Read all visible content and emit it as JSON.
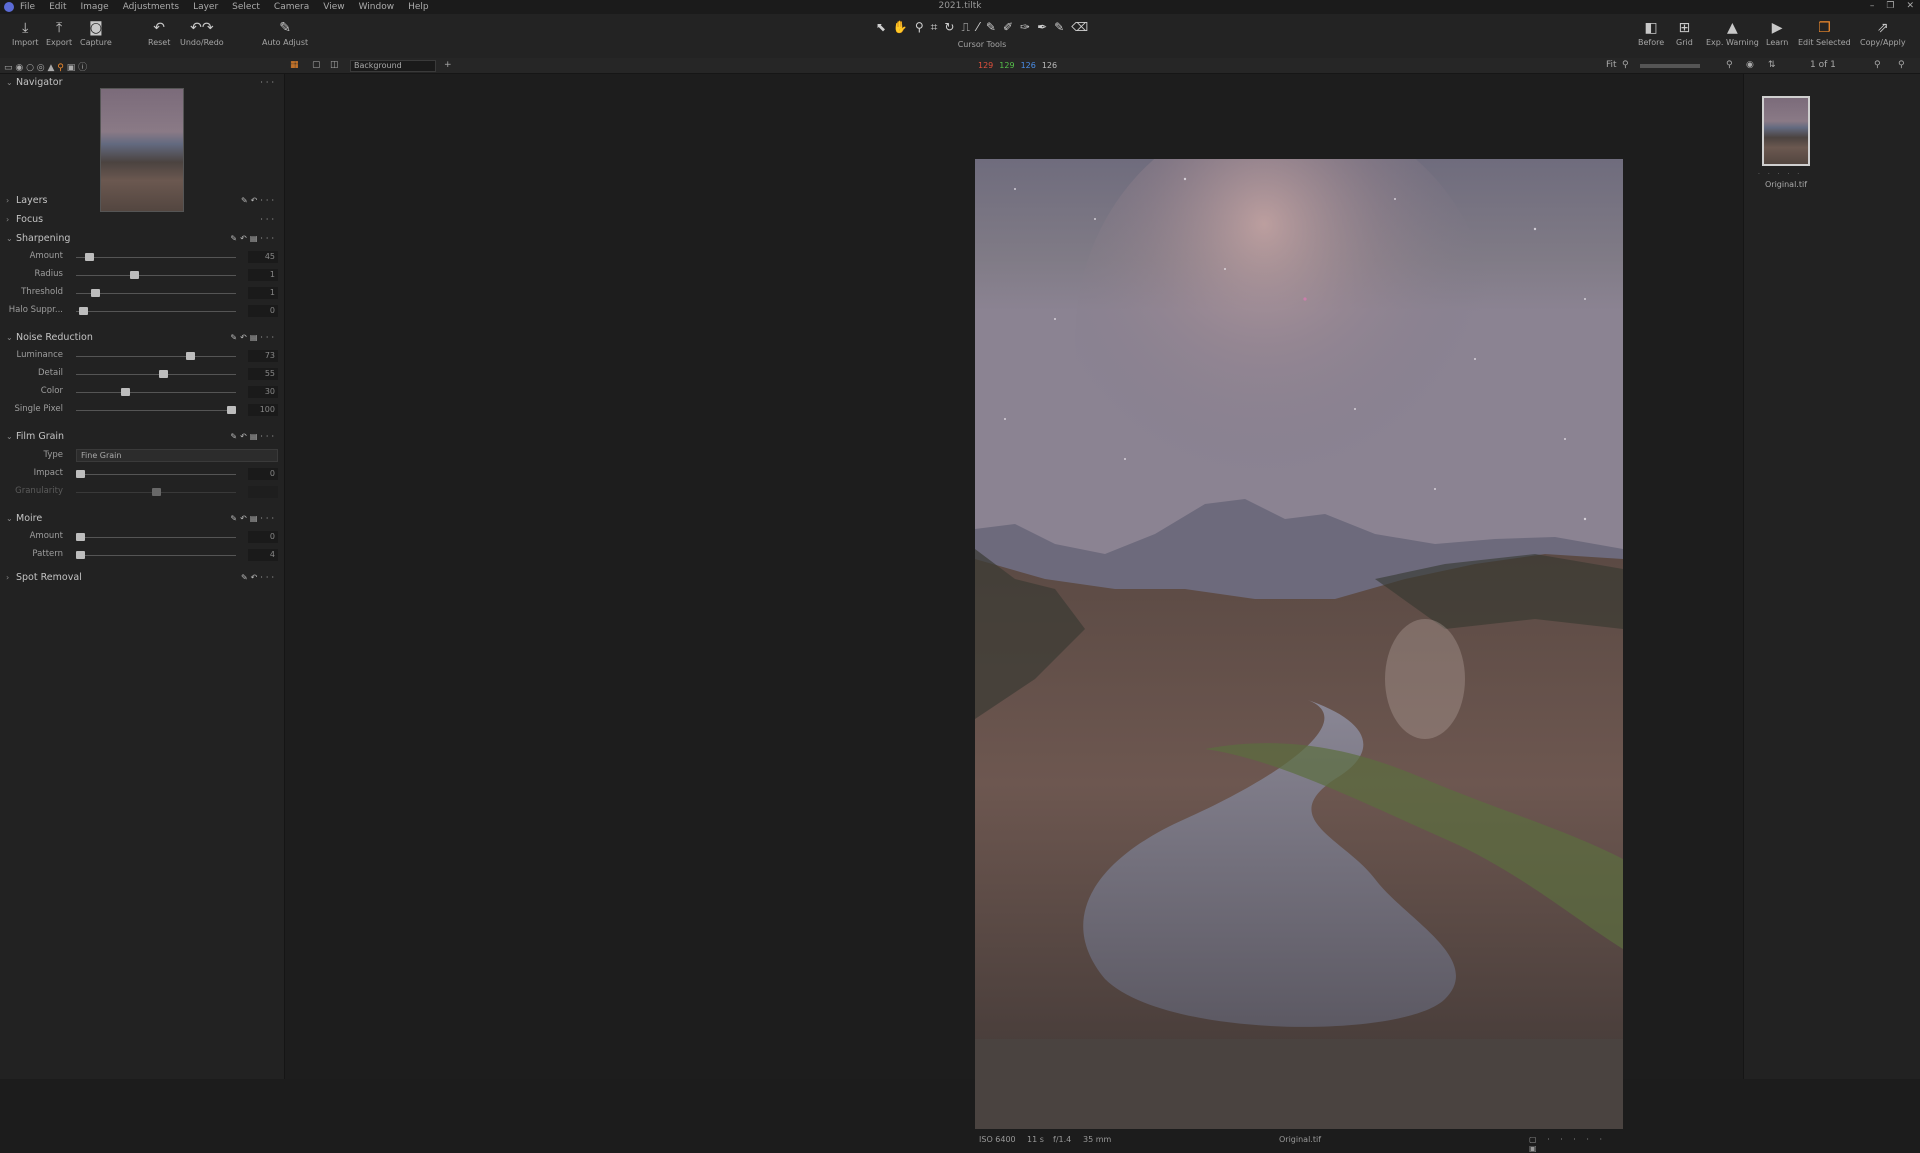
{
  "menu": {
    "items": [
      "File",
      "Edit",
      "Image",
      "Adjustments",
      "Layer",
      "Select",
      "Camera",
      "View",
      "Window",
      "Help"
    ],
    "title": "2021.tiltk",
    "winctl": [
      "–",
      "❐",
      "✕"
    ]
  },
  "toolbar": {
    "left": [
      {
        "label": "Import",
        "icon": "⤓"
      },
      {
        "label": "Export",
        "icon": "⤒"
      },
      {
        "label": "Capture",
        "icon": "◙"
      },
      {
        "label": "Reset",
        "icon": "↶"
      },
      {
        "label": "Undo/Redo",
        "icon": "↶↷"
      },
      {
        "label": "Auto Adjust",
        "icon": "✎"
      }
    ],
    "cursor_tools": {
      "label": "Cursor Tools",
      "icons": [
        "⬉",
        "✋",
        "⚲",
        "⌗",
        "↻",
        "⎍",
        "⁄",
        "✎",
        "✐",
        "✑",
        "✒",
        "✎",
        "⌫"
      ]
    },
    "right": [
      {
        "label": "Before",
        "icon": "◧"
      },
      {
        "label": "Grid",
        "icon": "⊞"
      },
      {
        "label": "Exp. Warning",
        "icon": "▲"
      },
      {
        "label": "Learn",
        "icon": "▶"
      },
      {
        "label": "Edit Selected",
        "icon": "❐"
      },
      {
        "label": "Copy/Apply",
        "icon": "⇗"
      }
    ]
  },
  "subbar": {
    "background_label": "Background",
    "rgb": [
      {
        "v": "129",
        "c": "#e0503c"
      },
      {
        "v": "129",
        "c": "#55c04a"
      },
      {
        "v": "126",
        "c": "#4a8ee8"
      },
      {
        "v": "126",
        "c": "#bbbbbb"
      }
    ],
    "fit": "Fit",
    "count": "1 of 1"
  },
  "panels": {
    "navigator": "Navigator",
    "layers": "Layers",
    "focus": "Focus",
    "sharpening": {
      "title": "Sharpening",
      "sliders": [
        {
          "label": "Amount",
          "value": "45",
          "pos": 0.06
        },
        {
          "label": "Radius",
          "value": "1",
          "pos": 0.36
        },
        {
          "label": "Threshold",
          "value": "1",
          "pos": 0.1
        },
        {
          "label": "Halo Suppr...",
          "value": "0",
          "pos": 0.02
        }
      ]
    },
    "noise": {
      "title": "Noise Reduction",
      "sliders": [
        {
          "label": "Luminance",
          "value": "73",
          "pos": 0.73
        },
        {
          "label": "Detail",
          "value": "55",
          "pos": 0.55
        },
        {
          "label": "Color",
          "value": "30",
          "pos": 0.3
        },
        {
          "label": "Single Pixel",
          "value": "100",
          "pos": 1.0
        }
      ]
    },
    "filmgrain": {
      "title": "Film Grain",
      "type_label": "Type",
      "type_value": "Fine Grain",
      "sliders": [
        {
          "label": "Impact",
          "value": "0",
          "pos": 0.0
        },
        {
          "label": "Granularity",
          "value": "",
          "pos": 0.5
        }
      ]
    },
    "moire": {
      "title": "Moire",
      "sliders": [
        {
          "label": "Amount",
          "value": "0",
          "pos": 0.0
        },
        {
          "label": "Pattern",
          "value": "4",
          "pos": 0.0
        }
      ]
    },
    "spot": "Spot Removal"
  },
  "viewer": {
    "caption": {
      "iso": "ISO 6400",
      "shutter": "11 s",
      "aperture": "f/1.4",
      "focal": "35 mm",
      "filename": "Original.tif"
    }
  },
  "browser": {
    "filename": "Original.tif",
    "stars": "· · · · ·"
  }
}
